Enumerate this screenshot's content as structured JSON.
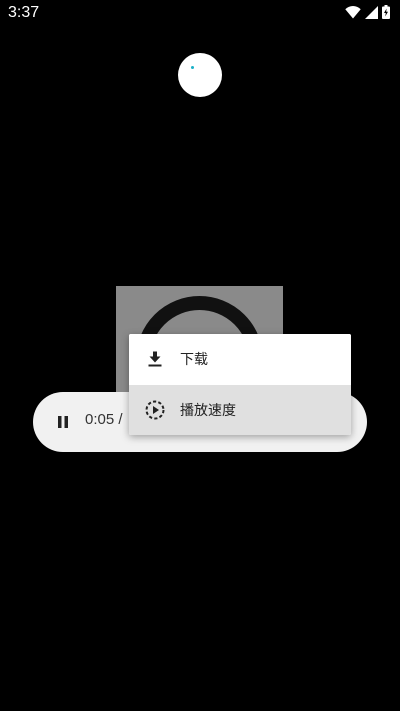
{
  "status_bar": {
    "time": "3:37",
    "icons": [
      "wifi-icon",
      "signal-icon",
      "battery-charging-icon"
    ]
  },
  "player": {
    "time_display": "0:05 /",
    "state": "playing"
  },
  "menu": {
    "items": [
      {
        "label": "下载",
        "icon": "download-icon"
      },
      {
        "label": "播放速度",
        "icon": "playback-speed-icon",
        "highlighted": true
      }
    ]
  },
  "colors": {
    "background": "#000000",
    "player_bar": "#f1f1f1",
    "menu_background": "#ffffff",
    "menu_highlight": "#e0e0e0",
    "loading_dot": "#1ab0c7"
  }
}
